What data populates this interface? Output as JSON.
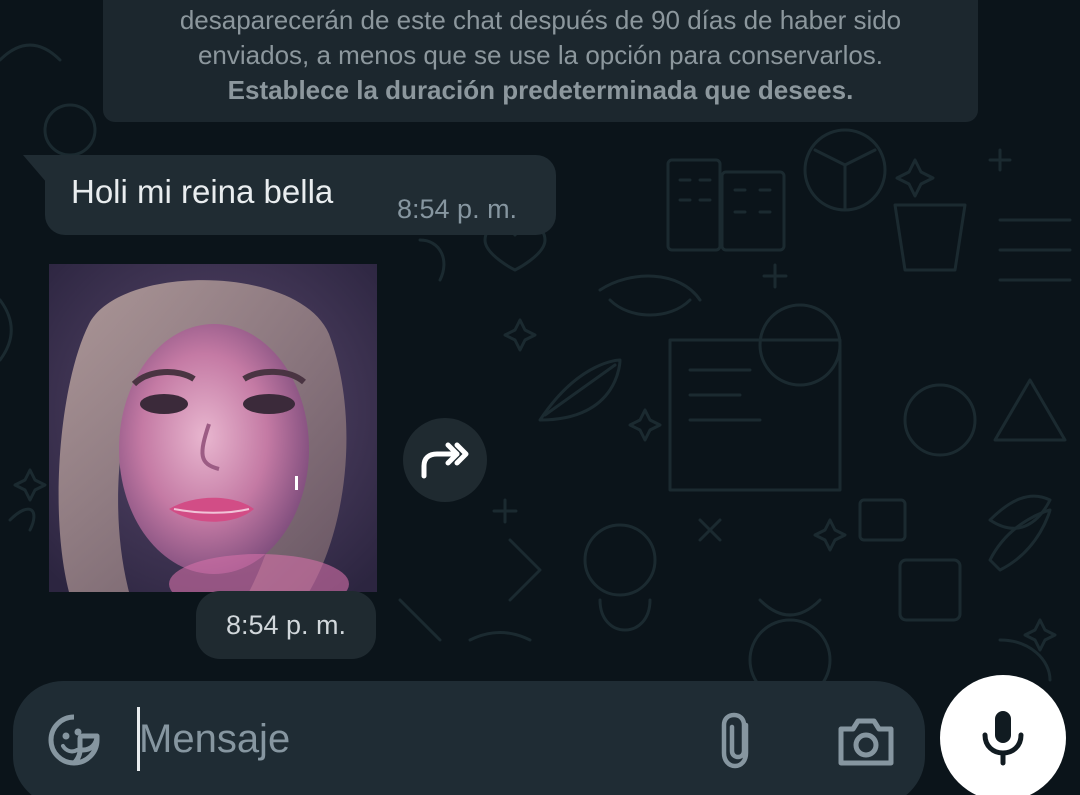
{
  "notice": {
    "line1": "desaparecerán de este chat después de 90 días de haber sido",
    "line2": "enviados, a menos que se use la opción para conservarlos.",
    "link": "Establece la duración predeterminada que desees."
  },
  "messages": [
    {
      "text": "Holi mi reina bella",
      "time": "8:54 p. m."
    },
    {
      "type": "sticker",
      "time": "8:54 p. m."
    }
  ],
  "composer": {
    "placeholder": "Mensaje"
  },
  "icons": {
    "emoji": "sticker-smiley-icon",
    "attach": "paperclip-icon",
    "camera": "camera-icon",
    "mic": "microphone-icon",
    "forward": "forward-icon"
  },
  "colors": {
    "background": "#0b141a",
    "bubble": "#202c33",
    "composer": "#1f2c34",
    "text": "#e9edef",
    "muted": "#8696a0",
    "mic_button": "#ffffff"
  }
}
